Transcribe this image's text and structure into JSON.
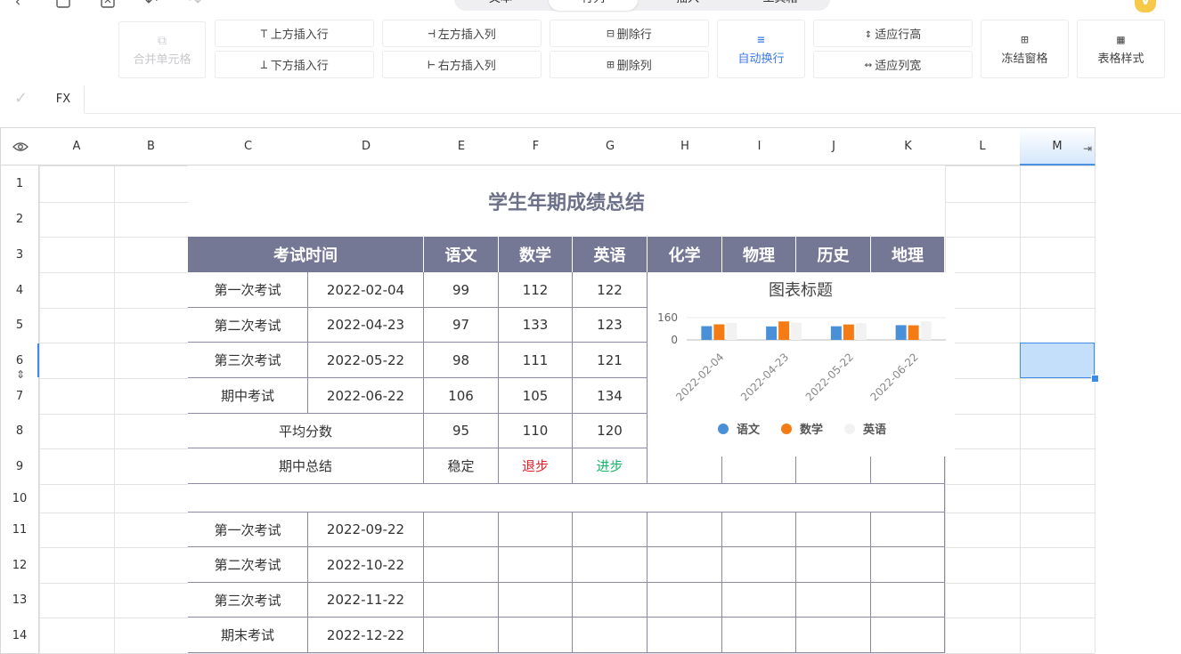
{
  "topbar": {
    "tabs": [
      "文本",
      "行列",
      "插入",
      "工具箱"
    ],
    "active_tab_index": 1,
    "badge": "V"
  },
  "toolbar": {
    "merge": "合并单元格",
    "insert_row_above": "上方插入行",
    "insert_row_below": "下方插入行",
    "insert_col_left": "左方插入列",
    "insert_col_right": "右方插入列",
    "delete_row": "删除行",
    "delete_col": "删除列",
    "auto_wrap": "自动换行",
    "fit_row_height": "适应行高",
    "fit_col_width": "适应列宽",
    "freeze": "冻结窗格",
    "table_style": "表格样式"
  },
  "formula_bar": {
    "label": "FX",
    "value": ""
  },
  "columns": [
    "A",
    "B",
    "C",
    "D",
    "E",
    "F",
    "G",
    "H",
    "I",
    "J",
    "K",
    "L",
    "M"
  ],
  "rows": [
    "1",
    "2",
    "3",
    "4",
    "5",
    "6",
    "7",
    "8",
    "9",
    "10",
    "11",
    "12",
    "13",
    "14"
  ],
  "selected_column": "M",
  "selected_row": "6",
  "sheet": {
    "title": "学生年期成绩总结",
    "header": {
      "time": "考试时间",
      "subjects": [
        "语文",
        "数学",
        "英语",
        "化学",
        "物理",
        "历史",
        "地理"
      ]
    },
    "exams1": [
      {
        "name": "第一次考试",
        "date": "2022-02-04",
        "scores": [
          "99",
          "112",
          "122"
        ]
      },
      {
        "name": "第二次考试",
        "date": "2022-04-23",
        "scores": [
          "97",
          "133",
          "123"
        ]
      },
      {
        "name": "第三次考试",
        "date": "2022-05-22",
        "scores": [
          "98",
          "111",
          "121"
        ]
      },
      {
        "name": "期中考试",
        "date": "2022-06-22",
        "scores": [
          "106",
          "105",
          "134"
        ]
      }
    ],
    "average": {
      "label": "平均分数",
      "scores": [
        "95",
        "110",
        "120"
      ]
    },
    "summary": {
      "label": "期中总结",
      "values": [
        "稳定",
        "退步",
        "进步"
      ]
    },
    "exams2": [
      {
        "name": "第一次考试",
        "date": "2022-09-22"
      },
      {
        "name": "第二次考试",
        "date": "2022-10-22"
      },
      {
        "name": "第三次考试",
        "date": "2022-11-22"
      },
      {
        "name": "期末考试",
        "date": "2022-12-22"
      }
    ]
  },
  "colors": {
    "header_bg": "#747894",
    "series": [
      "#4a90d9",
      "#f57c14",
      "#f2f2f2"
    ],
    "selection": "#c4dffa"
  },
  "chart_data": {
    "type": "bar",
    "title": "图表标题",
    "categories": [
      "2022-02-04",
      "2022-04-23",
      "2022-05-22",
      "2022-06-22"
    ],
    "series": [
      {
        "name": "语文",
        "values": [
          99,
          97,
          98,
          106
        ]
      },
      {
        "name": "数学",
        "values": [
          112,
          133,
          111,
          105
        ]
      },
      {
        "name": "英语",
        "values": [
          122,
          123,
          121,
          134
        ]
      }
    ],
    "y_ticks": [
      "0",
      "160"
    ],
    "ylim": [
      0,
      160
    ],
    "legend": "bottom"
  }
}
